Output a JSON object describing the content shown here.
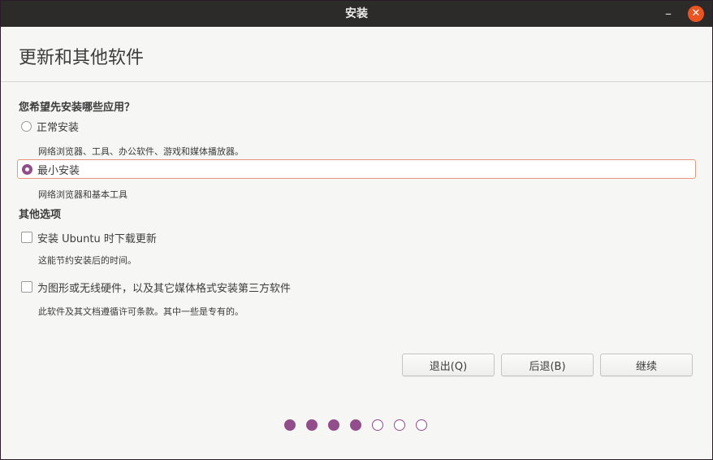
{
  "window": {
    "title": "安装",
    "minimize_glyph": "–",
    "close_glyph": "✕"
  },
  "page": {
    "title": "更新和其他软件"
  },
  "install_type": {
    "question": "您希望先安装哪些应用？",
    "options": [
      {
        "label": "正常安装",
        "description": "网络浏览器、工具、办公软件、游戏和媒体播放器。",
        "selected": false
      },
      {
        "label": "最小安装",
        "description": "网络浏览器和基本工具",
        "selected": true
      }
    ]
  },
  "other_options": {
    "heading": "其他选项",
    "checkboxes": [
      {
        "label": "安装 Ubuntu 时下载更新",
        "description": "这能节约安装后的时间。",
        "checked": false
      },
      {
        "label": "为图形或无线硬件，以及其它媒体格式安装第三方软件",
        "description": "此软件及其文档遵循许可条款。其中一些是专有的。",
        "checked": false
      }
    ]
  },
  "buttons": {
    "quit": "退出(Q)",
    "back": "后退(B)",
    "continue": "继续"
  },
  "progress": {
    "total_steps": 7,
    "completed_steps": 4
  },
  "colors": {
    "accent": "#924d8b",
    "close": "#e95420",
    "titlebar": "#2d2b29",
    "selection_border": "#e9977c"
  },
  "icons": {
    "minimize": "minimize-icon",
    "close": "close-icon"
  }
}
